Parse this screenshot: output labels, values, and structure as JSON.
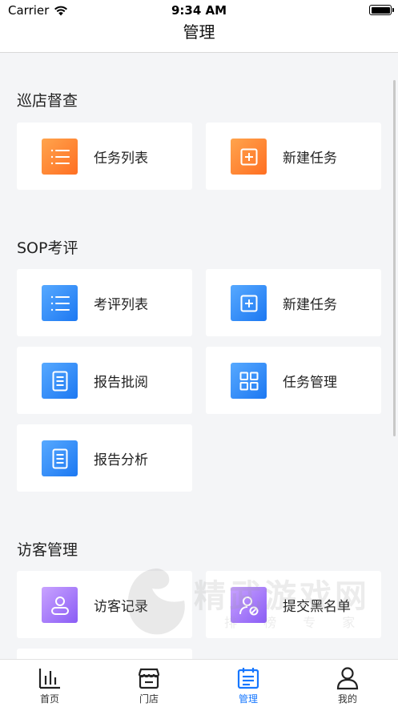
{
  "status_bar": {
    "carrier": "Carrier",
    "time": "9:34 AM"
  },
  "nav": {
    "title": "管理"
  },
  "sections": [
    {
      "title": "巡店督查"
    },
    {
      "title": "SOP考评"
    },
    {
      "title": "访客管理"
    }
  ],
  "cards": {
    "inspection_task_list": {
      "label": "任务列表",
      "icon": "list-icon"
    },
    "inspection_new_task": {
      "label": "新建任务",
      "icon": "plus-square-icon"
    },
    "sop_eval_list": {
      "label": "考评列表",
      "icon": "list-icon"
    },
    "sop_new_task": {
      "label": "新建任务",
      "icon": "plus-square-icon"
    },
    "sop_report_review": {
      "label": "报告批阅",
      "icon": "document-icon"
    },
    "sop_task_manage": {
      "label": "任务管理",
      "icon": "grid-icon"
    },
    "sop_report_analysis": {
      "label": "报告分析",
      "icon": "document-icon"
    },
    "visitor_records": {
      "label": "访客记录",
      "icon": "user-card-icon"
    },
    "visitor_blacklist": {
      "label": "提交黑名单",
      "icon": "user-block-icon"
    }
  },
  "tabs": [
    {
      "label": "首页",
      "icon": "chart-icon"
    },
    {
      "label": "门店",
      "icon": "store-icon"
    },
    {
      "label": "管理",
      "icon": "calendar-list-icon",
      "active": true
    },
    {
      "label": "我的",
      "icon": "person-icon"
    }
  ],
  "watermark": {
    "text": "精武游戏网",
    "sub": "排 榜 专 家"
  },
  "colors": {
    "accent_blue": "#1677ff",
    "orange_tile": "#ff8a33",
    "blue_tile": "#3d8ff7",
    "purple_tile": "#a77cf8"
  }
}
